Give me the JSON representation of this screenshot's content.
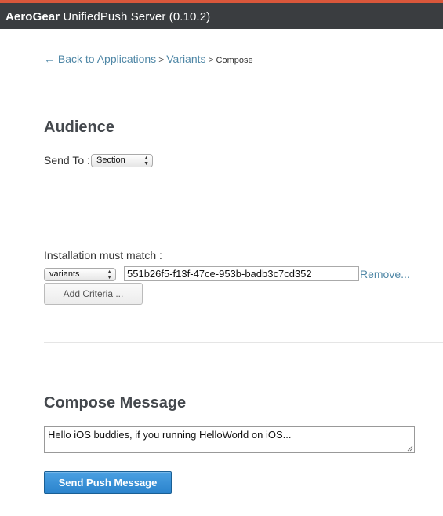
{
  "header": {
    "brand": "AeroGear",
    "title_rest": " UnifiedPush Server (0.10.2)"
  },
  "breadcrumb": {
    "arrow": "←",
    "back_label": "Back to Applications",
    "separator": ">",
    "variants_label": "Variants",
    "current": "Compose"
  },
  "audience": {
    "heading": "Audience",
    "send_to_label": "Send To :",
    "send_to_value": "Section"
  },
  "criteria": {
    "label": "Installation must match :",
    "field_value": "variants",
    "match_value": "551b26f5-f13f-47ce-953b-badb3c7cd352",
    "remove_label": "Remove...",
    "add_label": "Add Criteria ..."
  },
  "compose": {
    "heading": "Compose Message",
    "message": "Hello iOS buddies, if you running HelloWorld on iOS...",
    "send_label": "Send Push Message"
  },
  "colors": {
    "header_bg": "#3a3d40",
    "header_accent": "#d9573b",
    "link": "#4f87a6",
    "primary": "#2b83cc"
  }
}
